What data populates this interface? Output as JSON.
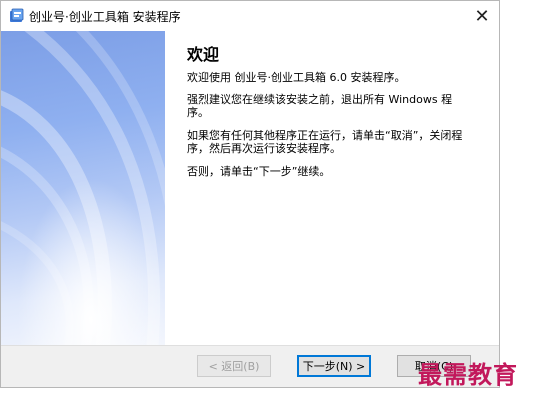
{
  "window": {
    "title": "创业号·创业工具箱 安装程序",
    "close_glyph": "✕"
  },
  "content": {
    "heading": "欢迎",
    "paragraph_1": "欢迎使用 创业号·创业工具箱 6.0 安装程序。",
    "paragraph_2": "强烈建议您在继续该安装之前，退出所有 Windows 程序。",
    "paragraph_3": "如果您有任何其他程序正在运行，请单击“取消”，关闭程序，然后再次运行该安装程序。",
    "paragraph_4": "否则，请单击“下一步”继续。"
  },
  "buttons": {
    "back_label": "< 返回(B)",
    "next_label": "下一步(N) >",
    "cancel_label": "取消(C)"
  },
  "watermark": "最需教育",
  "colors": {
    "banner_top": "#7c9ee6",
    "banner_bottom": "#f3f6fd",
    "accent": "#0078d7",
    "watermark": "#c2185b"
  }
}
